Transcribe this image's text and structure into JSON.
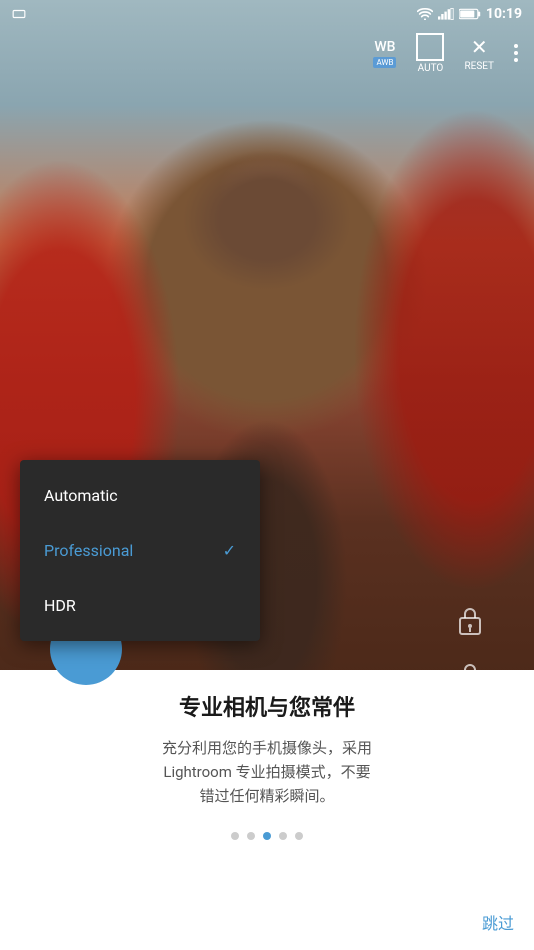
{
  "statusBar": {
    "time": "10:19"
  },
  "cameraControls": {
    "wb_label": "WB",
    "wb_badge": "AWB",
    "auto_label": "AUTO",
    "reset_label": "RESET"
  },
  "dropdown": {
    "items": [
      {
        "label": "Automatic",
        "active": false
      },
      {
        "label": "Professional",
        "active": true
      },
      {
        "label": "HDR",
        "active": false
      }
    ]
  },
  "bottomPanel": {
    "title": "专业相机与您常伴",
    "description": "充分利用您的手机摄像头，采用\nLightroom 专业拍摄模式，不要\n错过任何精彩瞬间。"
  },
  "pagination": {
    "dots": [
      false,
      false,
      true,
      false,
      false
    ]
  },
  "skipButton": {
    "label": "跳过"
  }
}
